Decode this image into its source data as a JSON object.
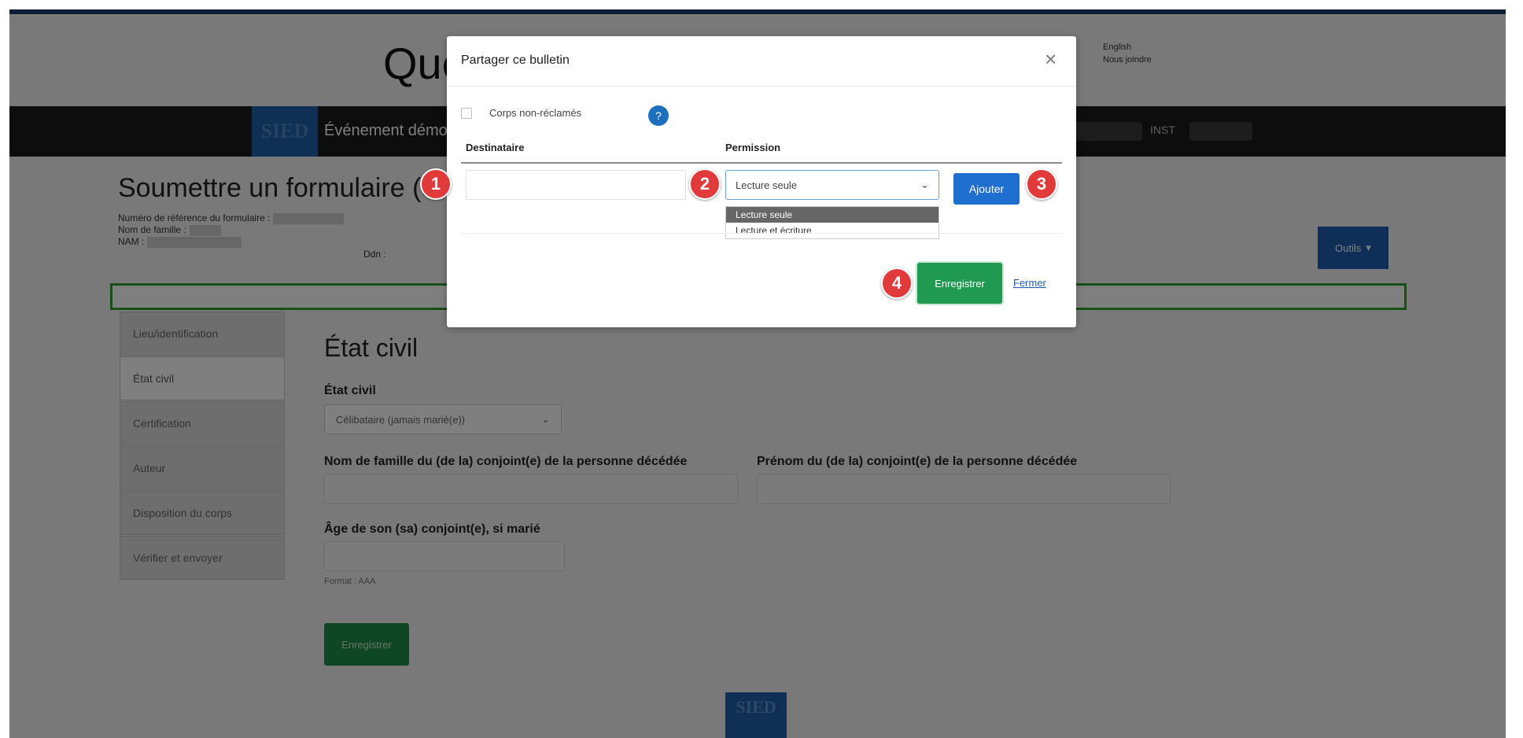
{
  "app": {
    "brand_title": "Québec",
    "lang_english": "English",
    "lang_contact": "Nous joindre"
  },
  "nav": {
    "logo_text": "SIED",
    "item_label": "Événement démographique",
    "user_label": "INST"
  },
  "form": {
    "title": "Soumettre un formulaire (SIED)",
    "ref_label": "Numéro de référence du formulaire :",
    "family_label": "Nom de famille :",
    "nam_label": "NAM :",
    "dob_label": "Ddn :",
    "tools_label": "Outils"
  },
  "sidebar": {
    "items": [
      {
        "label": "Lieu/identification"
      },
      {
        "label": "État civil"
      },
      {
        "label": "Certification"
      },
      {
        "label": "Auteur"
      },
      {
        "label": "Disposition du corps"
      },
      {
        "label": "Vérifier et envoyer"
      }
    ],
    "active_index": 1
  },
  "main": {
    "section_title": "État civil",
    "civil_label": "État civil",
    "civil_value": "Célibataire (jamais marié(e))",
    "spouse_last_label": "Nom de famille du (de la) conjoint(e) de la personne décédée",
    "spouse_first_label": "Prénom du (de la) conjoint(e) de la personne décédée",
    "spouse_age_label": "Âge de son (sa) conjoint(e), si marié",
    "age_hint": "Format : AAA",
    "save_label": "Enregistrer"
  },
  "modal": {
    "title": "Partager ce bulletin",
    "checkbox_label": "Corps non-réclamés",
    "col_recipient": "Destinataire",
    "col_permission": "Permission",
    "permission_value": "Lecture seule",
    "permission_options": [
      "Lecture seule",
      "Lecture et écriture"
    ],
    "add_label": "Ajouter",
    "save_label": "Enregistrer",
    "close_label": "Fermer",
    "help_icon": "?"
  },
  "steps": [
    "1",
    "2",
    "3",
    "4"
  ],
  "footer": {
    "logo_text": "SIED"
  },
  "colors": {
    "accent_blue": "#1f5fb0",
    "save_green": "#1f9a50",
    "step_red": "#e03a3a"
  }
}
